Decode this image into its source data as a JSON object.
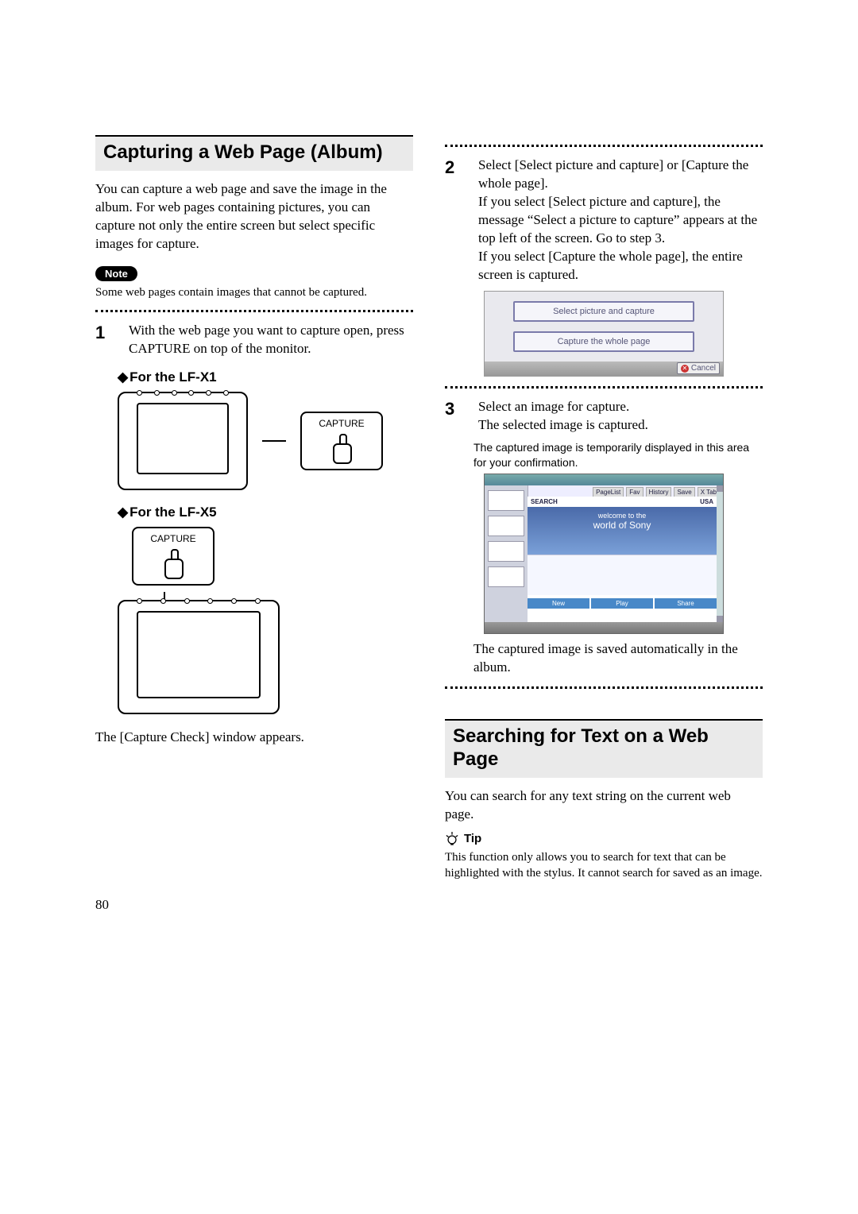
{
  "page_number": "80",
  "section1": {
    "title": "Capturing a Web Page (Album)",
    "intro": "You can capture a web page and save the image in the album. For web pages containing pictures, you can capture not only the entire screen but select specific images for capture.",
    "note_label": "Note",
    "note_text": "Some web pages contain images that cannot be captured.",
    "step1_text": "With the web page you want to capture open, press CAPTURE on top of the monitor.",
    "sub1": "For the LF-X1",
    "sub2": "For the LF-X5",
    "capture_label": "CAPTURE",
    "capture_check": "The [Capture Check] window appears."
  },
  "right": {
    "step2_text": "Select [Select picture and capture] or [Capture the whole page].\nIf you select [Select picture and capture], the message “Select a picture to capture” appears at the top left of the screen. Go to step 3.\nIf you select [Capture the whole page], the entire screen is captured.",
    "dialog_opt1": "Select picture and capture",
    "dialog_opt2": "Capture the whole page",
    "dialog_cancel": "Cancel",
    "step3_line1": "Select an image for capture.",
    "step3_line2": "The selected image is captured.",
    "caption": "The captured image is temporarily displayed in this area for your confirmation.",
    "welcome1": "welcome to the",
    "welcome2": "world of Sony",
    "tabs": {
      "a": "PageList",
      "b": "Fav",
      "c": "History",
      "d": "Save",
      "e": "X Tab"
    },
    "shot_usa": "USA",
    "shot_search": "SEARCH",
    "strip_new": "New",
    "strip_play": "Play",
    "strip_share": "Share",
    "shot_result": "The captured image is saved automatically in the album."
  },
  "section2": {
    "title": "Searching for Text on a Web Page",
    "intro": "You can search for any text string on the current web page.",
    "tip_label": "Tip",
    "tip_text": "This function only allows you to search for text that can be highlighted with the stylus. It cannot search for saved as an image."
  }
}
